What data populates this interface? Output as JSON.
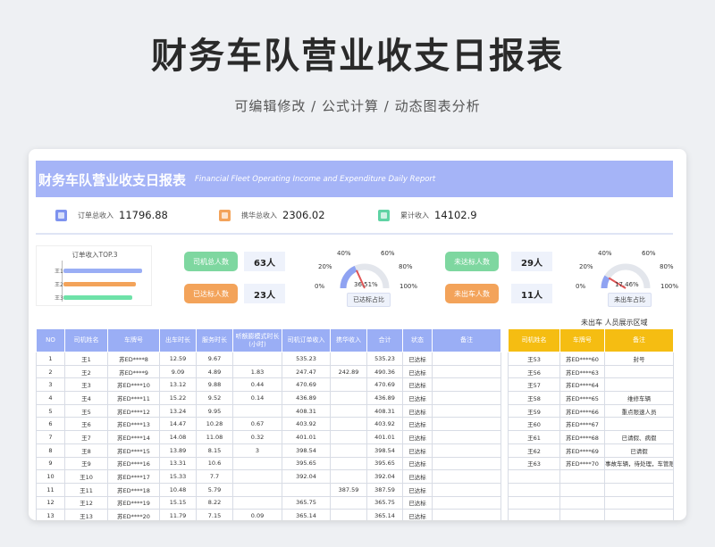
{
  "page": {
    "title": "财务车队营业收支日报表",
    "subtitle": "可编辑修改 /  公式计算  /  动态图表分析"
  },
  "sheet": {
    "title_cn": "财务车队营业收支日报表",
    "title_en": "Financial Fleet Operating Income and Expenditure Daily Report"
  },
  "kpis": [
    {
      "label": "订单总收入",
      "value": "11796.88",
      "color": "#7e93ef"
    },
    {
      "label": "携华总收入",
      "value": "2306.02",
      "color": "#f3a35a"
    },
    {
      "label": "累计收入",
      "value": "14102.9",
      "color": "#5fd3a4"
    }
  ],
  "top3": {
    "title": "订单收入TOP.3",
    "items": [
      {
        "label": "王1",
        "value": 535.23,
        "color": "#9aaef5"
      },
      {
        "label": "王2",
        "value": 490.36,
        "color": "#f3a35a"
      },
      {
        "label": "王3",
        "value": 470.69,
        "color": "#6ee2a8"
      }
    ]
  },
  "status_blocks": [
    {
      "label": "司机总人数",
      "value": "63人",
      "color": "#7ed7a0"
    },
    {
      "label": "已达标人数",
      "value": "23人",
      "color": "#f3a35a"
    },
    {
      "label": "未达标人数",
      "value": "29人",
      "color": "#7ed7a0"
    },
    {
      "label": "未出车人数",
      "value": "11人",
      "color": "#f3a35a"
    }
  ],
  "gauges": [
    {
      "percent_text": "36.51%",
      "fraction": 0.3651,
      "caption": "已达标占比",
      "ticks": [
        "0%",
        "20%",
        "40%",
        "60%",
        "80%",
        "100%"
      ]
    },
    {
      "percent_text": "17.46%",
      "fraction": 0.1746,
      "caption": "未出车占比",
      "ticks": [
        "0%",
        "20%",
        "40%",
        "60%",
        "80%",
        "100%"
      ]
    }
  ],
  "main_table": {
    "headers": [
      "NO",
      "司机姓名",
      "车牌号",
      "出车时长",
      "服务时长",
      "听额膨模式时长(小时)",
      "司机订单收入",
      "携华收入",
      "合计",
      "状态",
      "备注"
    ],
    "rows": [
      [
        "1",
        "王1",
        "苏ED****8",
        "12.59",
        "9.67",
        "",
        "535.23",
        "",
        "535.23",
        "已达标",
        ""
      ],
      [
        "2",
        "王2",
        "苏ED****9",
        "9.09",
        "4.89",
        "1.83",
        "247.47",
        "242.89",
        "490.36",
        "已达标",
        ""
      ],
      [
        "3",
        "王3",
        "苏ED****10",
        "13.12",
        "9.88",
        "0.44",
        "470.69",
        "",
        "470.69",
        "已达标",
        ""
      ],
      [
        "4",
        "王4",
        "苏ED****11",
        "15.22",
        "9.52",
        "0.14",
        "436.89",
        "",
        "436.89",
        "已达标",
        ""
      ],
      [
        "5",
        "王5",
        "苏ED****12",
        "13.24",
        "9.95",
        "",
        "408.31",
        "",
        "408.31",
        "已达标",
        ""
      ],
      [
        "6",
        "王6",
        "苏ED****13",
        "14.47",
        "10.28",
        "0.67",
        "403.92",
        "",
        "403.92",
        "已达标",
        ""
      ],
      [
        "7",
        "王7",
        "苏ED****14",
        "14.08",
        "11.08",
        "0.32",
        "401.01",
        "",
        "401.01",
        "已达标",
        ""
      ],
      [
        "8",
        "王8",
        "苏ED****15",
        "13.89",
        "8.15",
        "3",
        "398.54",
        "",
        "398.54",
        "已达标",
        ""
      ],
      [
        "9",
        "王9",
        "苏ED****16",
        "13.31",
        "10.6",
        "",
        "395.65",
        "",
        "395.65",
        "已达标",
        ""
      ],
      [
        "10",
        "王10",
        "苏ED****17",
        "15.33",
        "7.7",
        "",
        "392.04",
        "",
        "392.04",
        "已达标",
        ""
      ],
      [
        "11",
        "王11",
        "苏ED****18",
        "10.48",
        "5.79",
        "",
        "",
        "387.59",
        "387.59",
        "已达标",
        ""
      ],
      [
        "12",
        "王12",
        "苏ED****19",
        "15.15",
        "8.22",
        "",
        "365.75",
        "",
        "365.75",
        "已达标",
        ""
      ],
      [
        "13",
        "王13",
        "苏ED****20",
        "11.79",
        "7.15",
        "0.09",
        "365.14",
        "",
        "365.14",
        "已达标",
        ""
      ]
    ]
  },
  "side_table": {
    "caption": "未出车 人员展示区域",
    "headers": [
      "司机姓名",
      "车牌号",
      "备注"
    ],
    "rows": [
      [
        "王53",
        "苏ED****60",
        "封号"
      ],
      [
        "王56",
        "苏ED****63",
        ""
      ],
      [
        "王57",
        "苏ED****64",
        ""
      ],
      [
        "王58",
        "苏ED****65",
        "维修车辆"
      ],
      [
        "王59",
        "苏ED****66",
        "重点限速人员"
      ],
      [
        "王60",
        "苏ED****67",
        ""
      ],
      [
        "王61",
        "苏ED****68",
        "已请假、病假"
      ],
      [
        "王62",
        "苏ED****69",
        "已请假"
      ],
      [
        "王63",
        "苏ED****70",
        "事故车辆，待处理，车管限速"
      ],
      [
        "",
        "",
        ""
      ],
      [
        "",
        "",
        ""
      ],
      [
        "",
        "",
        ""
      ],
      [
        "",
        "",
        ""
      ]
    ]
  }
}
